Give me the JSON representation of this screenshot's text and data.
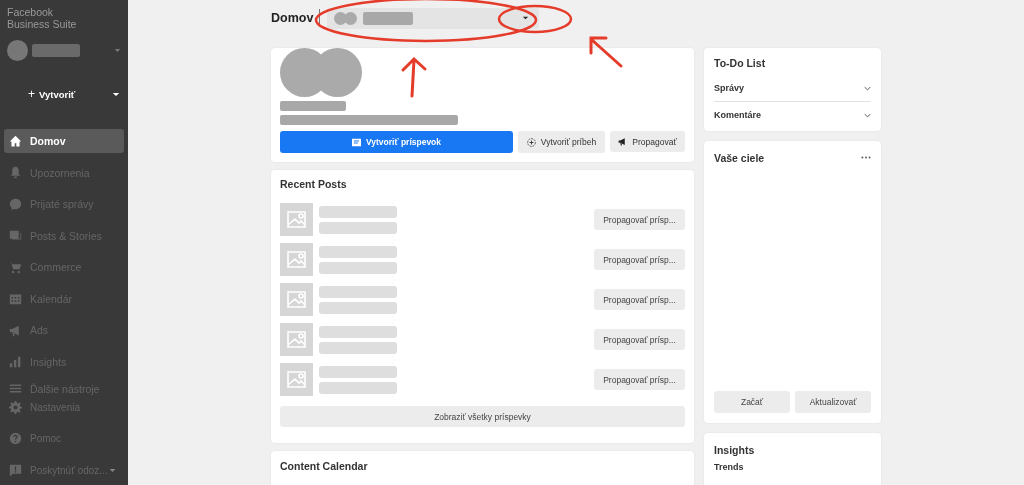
{
  "sidebar": {
    "brand": [
      "Facebook",
      "Business Suite"
    ],
    "create_icon": "+",
    "create_label": "Vytvoriť",
    "items": [
      {
        "label": "Domov",
        "selected": true
      },
      {
        "label": "Upozornenia",
        "selected": false
      },
      {
        "label": "Prijaté správy",
        "selected": false
      },
      {
        "label": "Posts & Stories",
        "selected": false
      },
      {
        "label": "Commerce",
        "selected": false
      },
      {
        "label": "Kalendár",
        "selected": false
      },
      {
        "label": "Ads",
        "selected": false
      },
      {
        "label": "Insights",
        "selected": false
      },
      {
        "label": "Ďalšie nástroje",
        "selected": false
      }
    ],
    "bottom_items": [
      {
        "label": "Nastavenia",
        "has_caret": false
      },
      {
        "label": "Pomoc",
        "has_caret": false
      },
      {
        "label": "Poskytnúť odoz...",
        "has_caret": true
      }
    ]
  },
  "header": {
    "title": "Domov"
  },
  "profile_card": {
    "buttons": [
      {
        "label": "Vytvoriť príspevok",
        "kind": "primary"
      },
      {
        "label": "Vytvoriť príbeh",
        "kind": "story"
      },
      {
        "label": "Propagovať",
        "kind": "promote"
      }
    ]
  },
  "recent_posts": {
    "title": "Recent Posts",
    "posts": [
      {
        "action": "Propagovať prísp..."
      },
      {
        "action": "Propagovať prísp..."
      },
      {
        "action": "Propagovať prísp..."
      },
      {
        "action": "Propagovať prísp..."
      },
      {
        "action": "Propagovať prísp..."
      }
    ],
    "show_all": "Zobraziť všetky príspevky"
  },
  "content_calendar": {
    "title": "Content Calendar"
  },
  "todo": {
    "title": "To-Do List",
    "items": [
      "Správy",
      "Komentáre"
    ]
  },
  "goals": {
    "title": "Vaše ciele",
    "buttons": [
      "Začať",
      "Aktualizovať"
    ]
  },
  "insights": {
    "title": "Insights",
    "subtitle": "Trends"
  }
}
